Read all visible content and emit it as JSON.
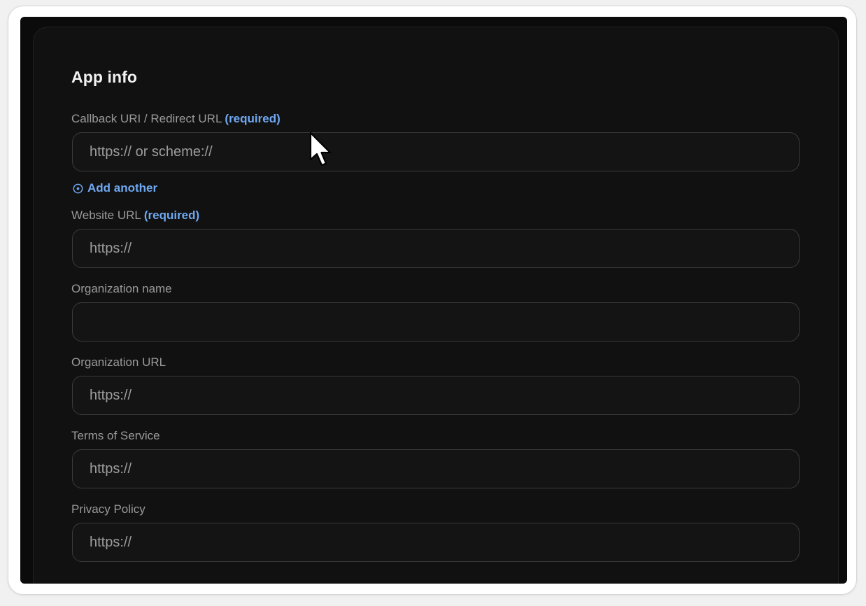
{
  "app_info": {
    "title": "App info",
    "callback": {
      "label": "Callback URI / Redirect URL",
      "required": "(required)",
      "placeholder": "https:// or scheme://"
    },
    "add_another": {
      "label": "Add another",
      "icon": "plus-circle-icon"
    },
    "website": {
      "label": "Website URL",
      "required": "(required)",
      "placeholder": "https://"
    },
    "organization_name": {
      "label": "Organization name",
      "placeholder": ""
    },
    "organization_url": {
      "label": "Organization URL",
      "placeholder": "https://"
    },
    "terms": {
      "label": "Terms of Service",
      "placeholder": "https://"
    },
    "privacy": {
      "label": "Privacy Policy",
      "placeholder": "https://"
    }
  },
  "colors": {
    "background": "#0b0b0b",
    "card": "#111111",
    "accent": "#6fa8f2",
    "label": "#9a9a9a",
    "border": "#3a3a3a"
  },
  "cursor": {
    "icon": "mouse-pointer-icon"
  }
}
